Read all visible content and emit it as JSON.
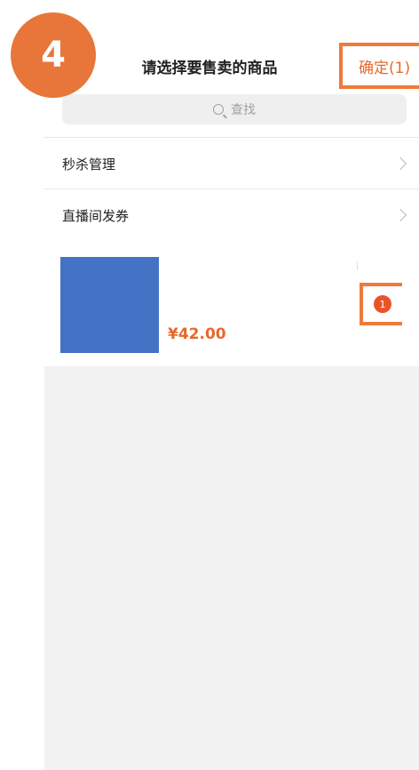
{
  "step_badge": "4",
  "header": {
    "title": "请选择要售卖的商品",
    "confirm_label": "确定(1)"
  },
  "search": {
    "placeholder": "查找"
  },
  "menu": {
    "items": [
      {
        "label": "秒杀管理"
      },
      {
        "label": "直播间发券"
      }
    ]
  },
  "product": {
    "price": "¥42.00",
    "selected_count": "1"
  },
  "colors": {
    "accent": "#e8682a",
    "badge": "#e8763a",
    "highlight_border": "#ef7a3b",
    "thumbnail": "#4472c4"
  }
}
